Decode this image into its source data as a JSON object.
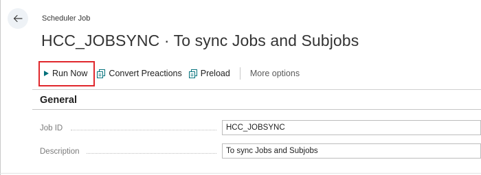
{
  "caption": "Scheduler Job",
  "title": "HCC_JOBSYNC · To sync Jobs and Subjobs",
  "actions": {
    "run_now": "Run Now",
    "convert_preactions": "Convert Preactions",
    "preload": "Preload",
    "more_options": "More options"
  },
  "colors": {
    "accent": "#00707a",
    "highlight": "#e0262b"
  },
  "icons": {
    "back": "arrow-left-icon",
    "run_now": "play-icon",
    "convert_preactions": "document-icon",
    "preload": "document-icon"
  },
  "group": {
    "title": "General",
    "fields": [
      {
        "label": "Job ID",
        "value": "HCC_JOBSYNC"
      },
      {
        "label": "Description",
        "value": "To sync Jobs and Subjobs"
      }
    ]
  }
}
